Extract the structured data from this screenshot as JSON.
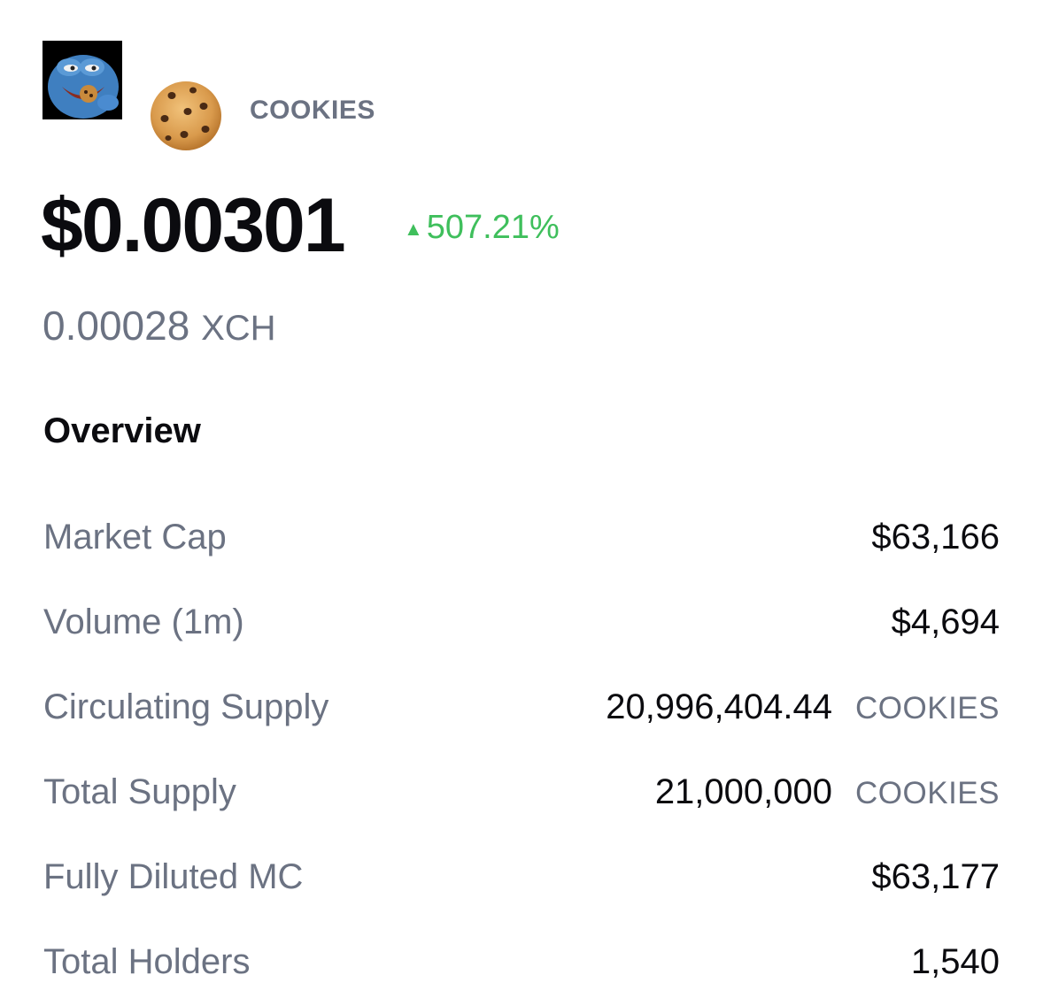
{
  "token": {
    "symbol": "COOKIES",
    "price_usd": "$0.00301",
    "change_arrow": "▲",
    "change_pct": "507.21%",
    "price_xch_value": "0.00028",
    "price_xch_unit": "XCH"
  },
  "overview": {
    "title": "Overview",
    "rows": [
      {
        "label": "Market Cap",
        "value": "$63,166",
        "unit": ""
      },
      {
        "label": "Volume (1m)",
        "value": "$4,694",
        "unit": ""
      },
      {
        "label": "Circulating Supply",
        "value": "20,996,404.44",
        "unit": "COOKIES"
      },
      {
        "label": "Total Supply",
        "value": "21,000,000",
        "unit": "COOKIES"
      },
      {
        "label": "Fully Diluted MC",
        "value": "$63,177",
        "unit": ""
      },
      {
        "label": "Total Holders",
        "value": "1,540",
        "unit": ""
      }
    ]
  },
  "colors": {
    "positive": "#3fbf5c",
    "muted": "#6b7282",
    "text": "#0b0b0f"
  },
  "icons": {
    "avatar": "pepe-avatar-icon",
    "token": "cookie-icon"
  }
}
